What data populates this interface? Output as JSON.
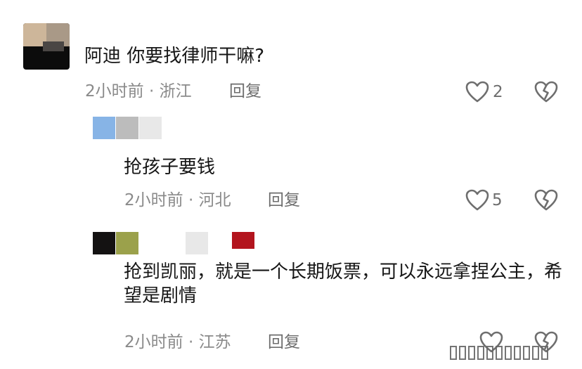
{
  "comments": [
    {
      "text": "阿迪 你要找律师干嘛?",
      "time": "2小时前",
      "location": "浙江",
      "reply_label": "回复",
      "likes": "2",
      "like_icon": "heart-outline-icon",
      "dislike_icon": "broken-heart-icon"
    },
    {
      "text": "抢孩子要钱",
      "time": "2小时前",
      "location": "河北",
      "reply_label": "回复",
      "likes": "5",
      "like_icon": "heart-outline-icon",
      "dislike_icon": "broken-heart-icon"
    },
    {
      "text": "抢到凯丽，就是一个长期饭票，可以永远拿捏公主，希望是剧情",
      "time": "2小时前",
      "location": "江苏",
      "reply_label": "回复",
      "likes": "",
      "like_icon": "heart-outline-icon",
      "dislike_icon": "broken-heart-icon"
    }
  ],
  "separator": " · ",
  "colors": {
    "text": "#161616",
    "meta": "#8a8a8a",
    "icon": "#6e6e6e",
    "redact_blue": "#87b4e6",
    "redact_gray": "#bcbcbc",
    "redact_light": "#e8e8e8",
    "redact_olive": "#9ba14b",
    "redact_red": "#b3151e",
    "redact_black": "#141212"
  }
}
